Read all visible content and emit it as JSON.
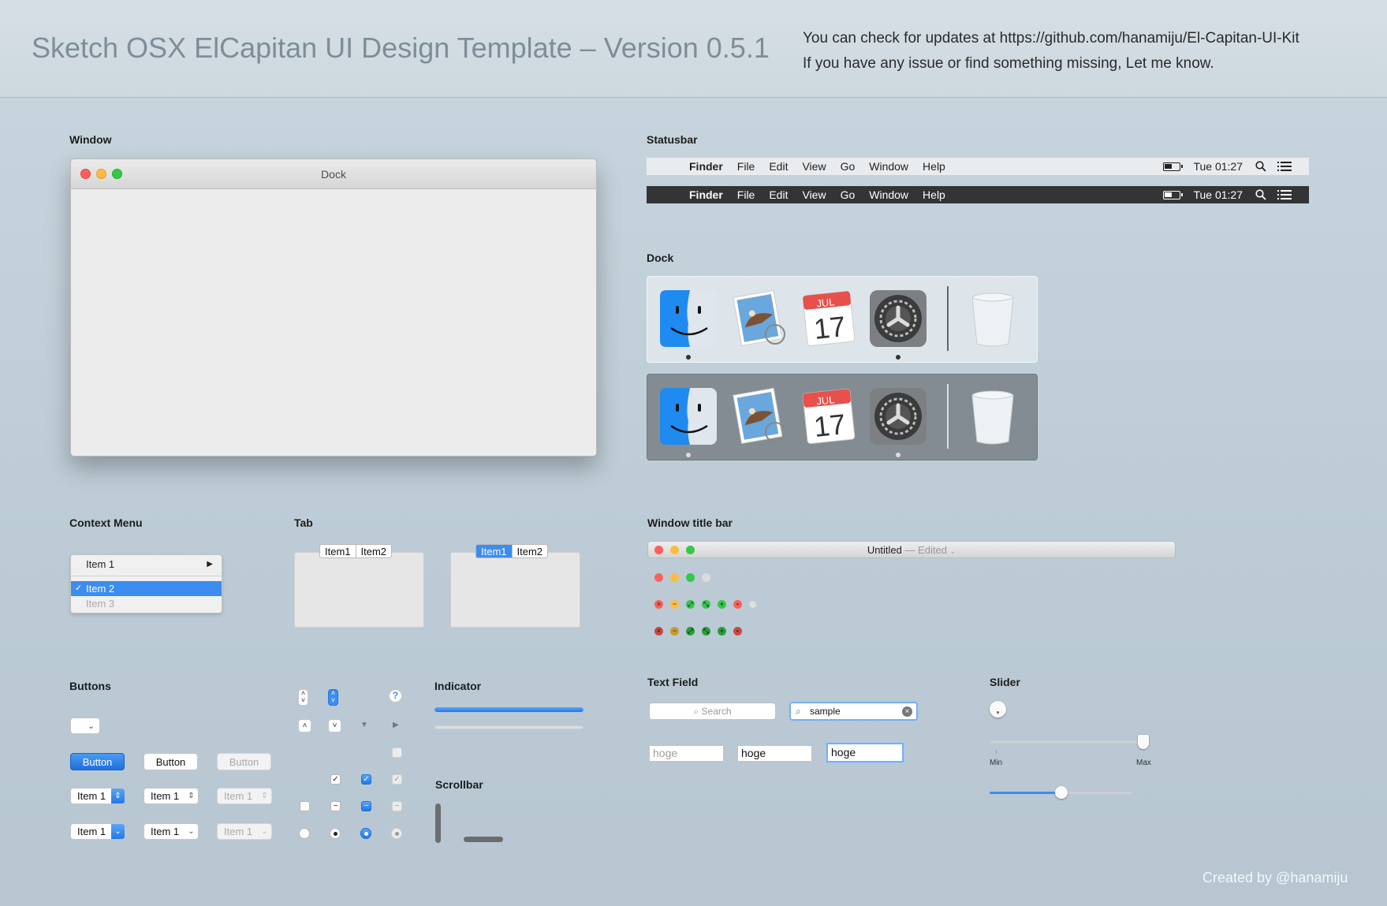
{
  "header": {
    "title": "Sketch OSX ElCapitan UI Design Template – Version 0.5.1",
    "updates_line1": "You can check for updates at  https://github.com/hanamiju/El-Capitan-UI-Kit",
    "updates_line2": "If you have any issue or find something missing, Let me know."
  },
  "sections": {
    "window": "Window",
    "statusbar": "Statusbar",
    "dock": "Dock",
    "context_menu": "Context Menu",
    "tab": "Tab",
    "window_title_bar": "Window title bar",
    "buttons": "Buttons",
    "indicator": "Indicator",
    "scrollbar": "Scrollbar",
    "text_field": "Text Field",
    "slider": "Slider"
  },
  "window": {
    "title": "Dock"
  },
  "statusbar": {
    "apple": "",
    "app": "Finder",
    "menus": [
      "File",
      "Edit",
      "View",
      "Go",
      "Window",
      "Help"
    ],
    "time": "Tue 01:27"
  },
  "dock": {
    "calendar_month": "JUL",
    "calendar_day": "17",
    "apps": [
      "finder-icon",
      "mail-icon",
      "calendar-icon",
      "system-preferences-icon",
      "trash-icon"
    ]
  },
  "context_menu": {
    "item1": "Item 1",
    "item2": "Item 2",
    "item3": "Item 3",
    "check": "✓",
    "submenu_arrow": "▶"
  },
  "tabs": {
    "item1": "Item1",
    "item2": "Item2"
  },
  "window_title_bar": {
    "title": "Untitled",
    "edited": "— Edited"
  },
  "buttons": {
    "button": "Button",
    "popup_item": "Item 1"
  },
  "text_field": {
    "search_placeholder": "Search",
    "search_value": "sample",
    "placeholder": "hoge",
    "value": "hoge"
  },
  "slider": {
    "min": "Min",
    "max": "Max",
    "value": 0.5
  },
  "indicator": {
    "progress": 1.0
  },
  "footer": "Created by @hanamiju",
  "colors": {
    "accent": "#3c8df0",
    "close": "#fc605c",
    "minimize": "#fdbc40",
    "zoom": "#34c84a"
  }
}
